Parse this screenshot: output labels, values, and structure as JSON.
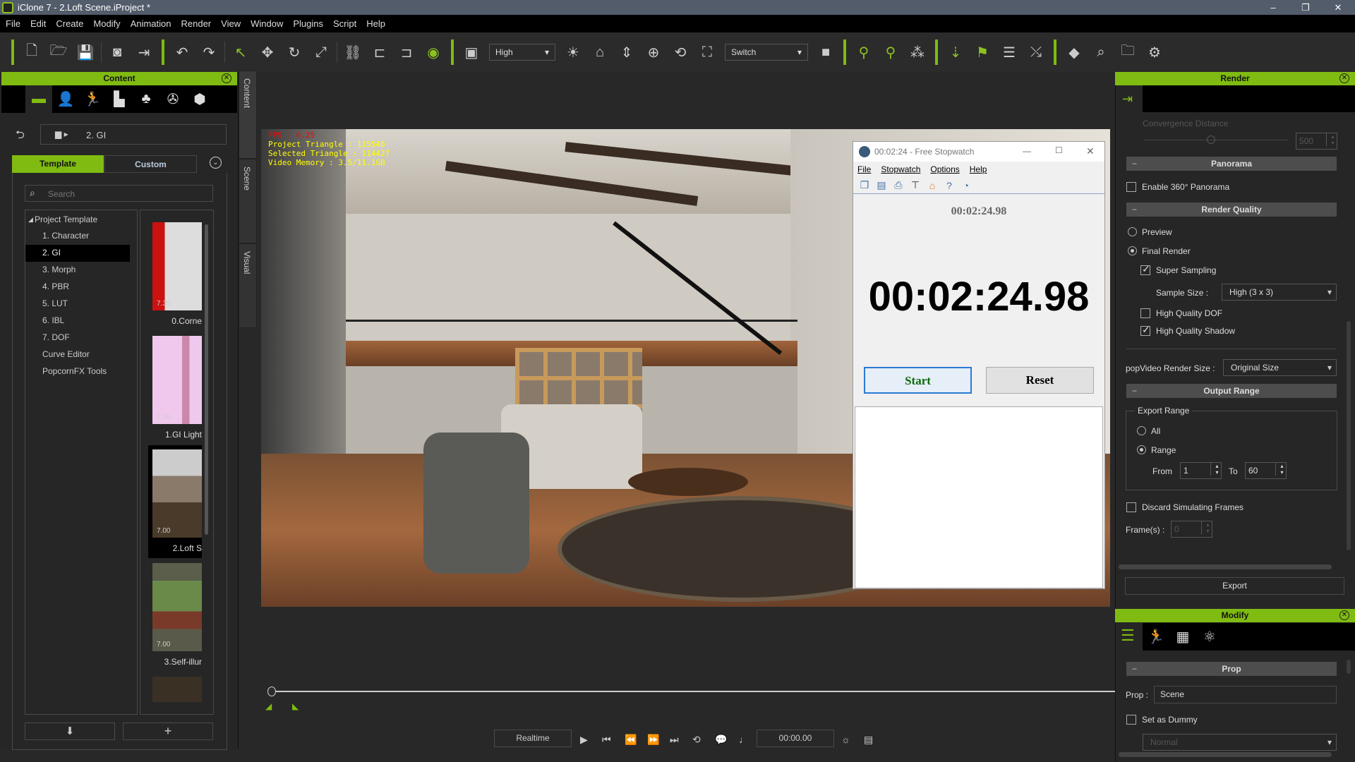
{
  "window": {
    "title": "iClone 7 - 2.Loft Scene.iProject *",
    "controls": [
      "–",
      "❐",
      "✕"
    ]
  },
  "menu": [
    "File",
    "Edit",
    "Create",
    "Modify",
    "Animation",
    "Render",
    "View",
    "Window",
    "Plugins",
    "Script",
    "Help"
  ],
  "toolbar": {
    "quality_select": "High",
    "camera_select": "Switch",
    "icons": [
      "new-file",
      "open-folder",
      "save",
      "render-preview",
      "export",
      "undo",
      "redo",
      "select",
      "move",
      "rotate",
      "scale",
      "link",
      "align-left",
      "align-right",
      "eye",
      "layout",
      "sun",
      "home",
      "fit-vertical",
      "fit-all",
      "camera-orbit",
      "frame",
      "camera",
      "motion-puppet",
      "motion-record",
      "crowd",
      "physics",
      "flag",
      "timeline-list",
      "path",
      "keyframe",
      "camera-zoom",
      "project-folder",
      "settings"
    ]
  },
  "content_panel": {
    "title": "Content",
    "breadcrumb": "2. GI",
    "tabs": [
      "Template",
      "Custom"
    ],
    "active_tab": "Template",
    "search_placeholder": "Search",
    "tree_root": "Project Template",
    "tree_items": [
      "1. Character",
      "2. GI",
      "3. Morph",
      "4. PBR",
      "5. LUT",
      "6. IBL",
      "7. DOF",
      "Curve Editor",
      "PopcornFX Tools"
    ],
    "selected_item": "2. GI",
    "thumbnails": [
      {
        "label": "0.Corne",
        "version": "7.30"
      },
      {
        "label": "1.GI Light",
        "version": "7.30"
      },
      {
        "label": "2.Loft S",
        "version": "7.00"
      },
      {
        "label": "3.Self-illur",
        "version": "7.00"
      }
    ]
  },
  "side_tabs": [
    "Content",
    "Scene",
    "Visual"
  ],
  "viewport": {
    "fps": "FPS : 6.25",
    "project_triangle": "Project Triangle : 115548",
    "selected_triangle": "Selected Triangle : 114427",
    "video_memory": "Video Memory : 3.5/11.1GB"
  },
  "stopwatch": {
    "title": "00:02:24 - Free Stopwatch",
    "menu": [
      "File",
      "Stopwatch",
      "Options",
      "Help"
    ],
    "small_time": "00:02:24.98",
    "big_time": "00:02:24.98",
    "start": "Start",
    "reset": "Reset"
  },
  "timeline": {
    "mode": "Realtime",
    "time": "00:00.00",
    "position": 0
  },
  "render_panel": {
    "title": "Render",
    "convergence_label": "Convergence Distance",
    "convergence_value": "500",
    "panorama_header": "Panorama",
    "enable_panorama": "Enable 360° Panorama",
    "quality_header": "Render Quality",
    "preview": "Preview",
    "final_render": "Final Render",
    "super_sampling": "Super Sampling",
    "sample_size_label": "Sample Size :",
    "sample_size": "High (3 x 3)",
    "hq_dof": "High Quality DOF",
    "hq_shadow": "High Quality Shadow",
    "popvideo_label": "popVideo Render Size :",
    "popvideo_size": "Original Size",
    "output_header": "Output Range",
    "export_range": "Export Range",
    "all": "All",
    "range": "Range",
    "from_label": "From",
    "from": "1",
    "to_label": "To",
    "to": "60",
    "discard": "Discard Simulating Frames",
    "frames_label": "Frame(s) :",
    "frames": "0",
    "export": "Export"
  },
  "modify_panel": {
    "title": "Modify",
    "prop_header": "Prop",
    "prop_label": "Prop :",
    "prop_value": "Scene",
    "set_dummy": "Set as Dummy",
    "mode": "Normal"
  },
  "colors": {
    "accent": "#80bb12",
    "titlebar": "#525c6b"
  }
}
